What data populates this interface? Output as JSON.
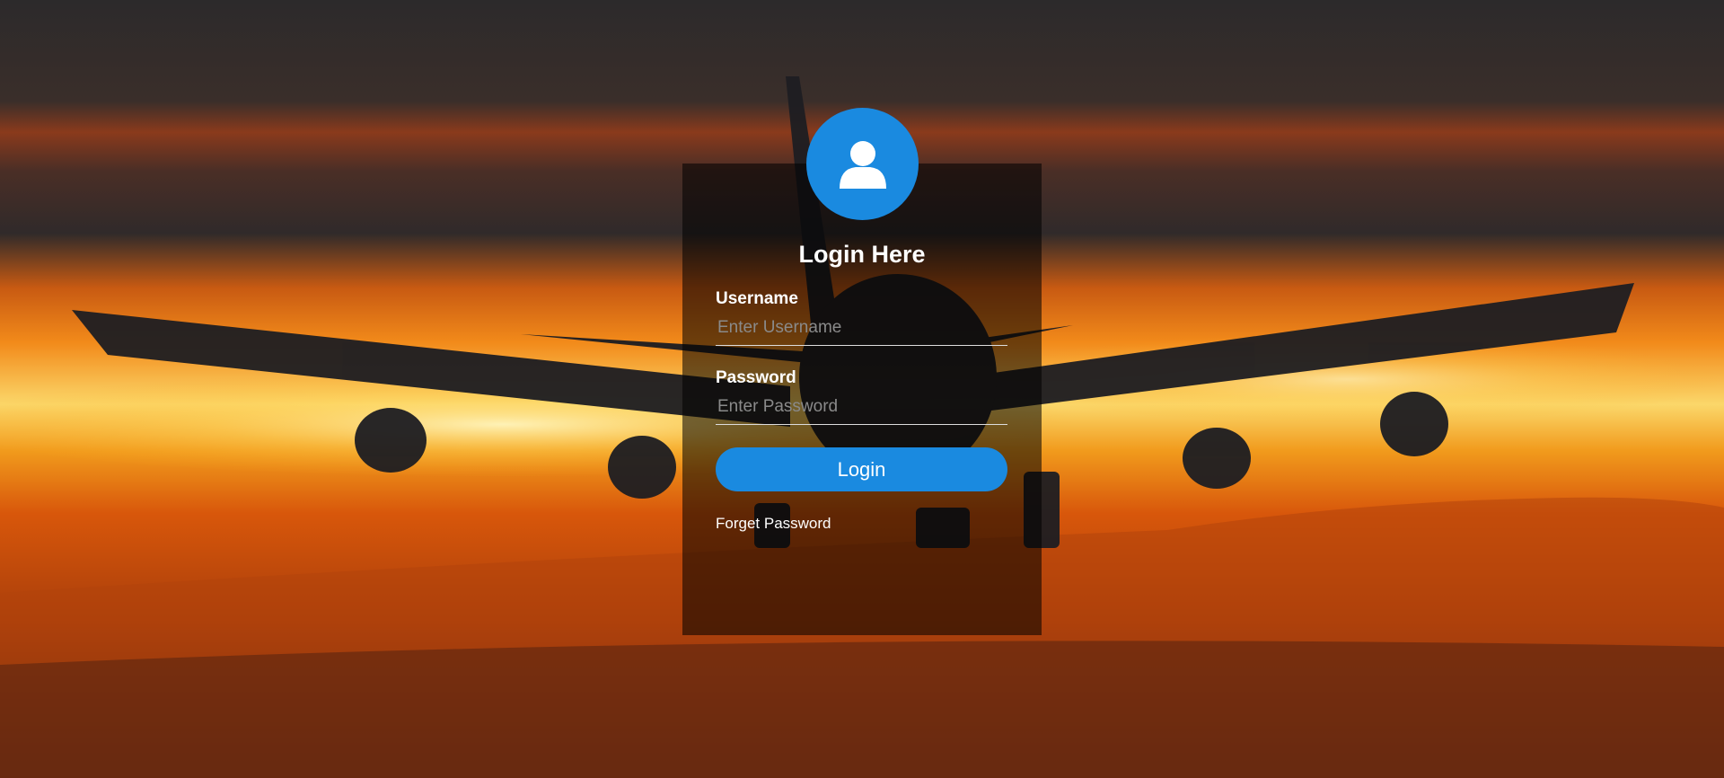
{
  "login": {
    "title": "Login Here",
    "username_label": "Username",
    "username_placeholder": "Enter Username",
    "username_value": "",
    "password_label": "Password",
    "password_placeholder": "Enter Password",
    "password_value": "",
    "login_button_label": "Login",
    "forget_password_label": "Forget Password"
  },
  "icons": {
    "avatar": "user-icon"
  },
  "colors": {
    "accent": "#1a8ae0",
    "panel_overlay": "rgba(0,0,0,0.55)",
    "text": "#ffffff"
  }
}
